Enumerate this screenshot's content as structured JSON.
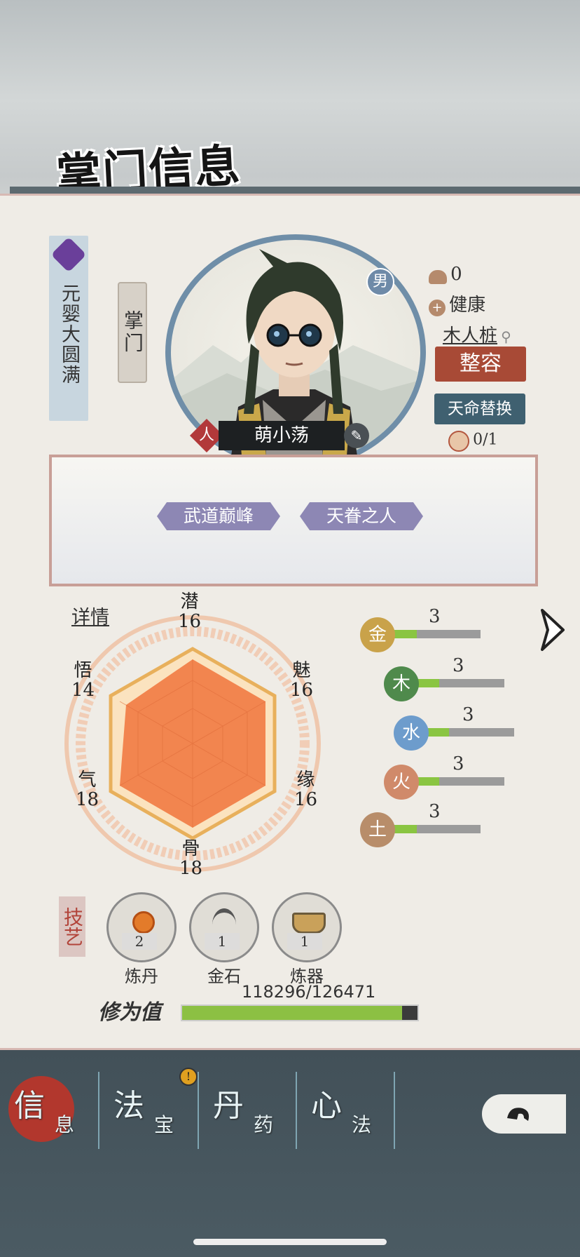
{
  "header": {
    "title": "掌门信息"
  },
  "realm": {
    "text": "元婴大圆满"
  },
  "role": {
    "text": "掌门"
  },
  "character": {
    "name": "萌小荡",
    "gender": "男",
    "race": "人"
  },
  "status": {
    "count": "0",
    "health": "健康",
    "location": "木人桩"
  },
  "buttons": {
    "reshape": "整容",
    "fate_swap": "天命替换",
    "fate_count": "0/1"
  },
  "traits": [
    "武道巅峰",
    "天眷之人"
  ],
  "details_link": "详情",
  "attributes": [
    {
      "label": "潜",
      "value": "16"
    },
    {
      "label": "魅",
      "value": "16"
    },
    {
      "label": "缘",
      "value": "16"
    },
    {
      "label": "骨",
      "value": "18"
    },
    {
      "label": "气",
      "value": "18"
    },
    {
      "label": "悟",
      "value": "14"
    }
  ],
  "elements": [
    {
      "glyph": "金",
      "value": "3",
      "fill": 0.28,
      "color": "#c9a24a"
    },
    {
      "glyph": "木",
      "value": "3",
      "fill": 0.26,
      "color": "#4f8a4c"
    },
    {
      "glyph": "水",
      "value": "3",
      "fill": 0.26,
      "color": "#6d9ccc"
    },
    {
      "glyph": "火",
      "value": "3",
      "fill": 0.26,
      "color": "#d08a6a"
    },
    {
      "glyph": "土",
      "value": "3",
      "fill": 0.28,
      "color": "#b88d6a"
    }
  ],
  "skills": {
    "label": "技艺",
    "items": [
      {
        "name": "炼丹",
        "count": "2"
      },
      {
        "name": "金石",
        "count": "1"
      },
      {
        "name": "炼器",
        "count": "1"
      }
    ]
  },
  "cultivation": {
    "label": "修为值",
    "value": "118296/126471",
    "fraction": 0.935
  },
  "nav": {
    "tabs": [
      {
        "big": "信",
        "small": "息"
      },
      {
        "big": "法",
        "small": "宝"
      },
      {
        "big": "丹",
        "small": "药"
      },
      {
        "big": "心",
        "small": "法"
      }
    ],
    "badge": "!"
  }
}
